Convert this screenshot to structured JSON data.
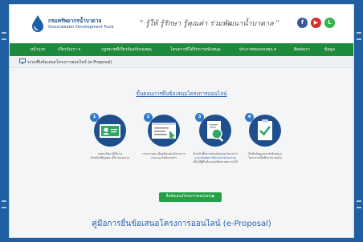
{
  "header": {
    "org_name_th": "กรมทรัพยากรน้ำบาดาล",
    "org_name_en": "Groundwater Development Fund",
    "slogan": "\" รู้ให้ รู้รักษา รู้คุณค่า ร่วมพัฒนาน้ำบาดาล \"",
    "social": [
      {
        "icon": "facebook-icon",
        "glyph": "f",
        "color": "#3b5998"
      },
      {
        "icon": "youtube-icon",
        "glyph": "▶",
        "color": "#d62d2d"
      },
      {
        "icon": "line-icon",
        "glyph": "L",
        "color": "#2fb34a"
      }
    ]
  },
  "nav": {
    "items": [
      "หน้าแรก",
      "เกี่ยวกับเรา ▾",
      "กฎหมายที่เกี่ยวข้องกับกองทุน",
      "โครงการที่ได้รับการสนับสนุน",
      "ประกาศของกองทุน ▾",
      "ติดต่อเรา",
      "ข้อมูล"
    ],
    "color": "#1e8a3c"
  },
  "breadcrumb": {
    "label": "ระบบยื่นข้อเสนอโครงการออนไลน์ (e-Proposal)"
  },
  "content": {
    "steps_title": "ขั้นตอนการยื่นข้อเสนอโครงการออนไลน์",
    "steps": [
      {
        "badge": "1",
        "icon": "id-card-icon",
        "caption_line1": "ลงทะเบียน ผู้ใช้งาน",
        "caption_line2": "สำหรับนิติบุคคล หรือ หน่วยงาน"
      },
      {
        "badge": "2",
        "icon": "online-form-icon",
        "caption_line1": "กรอกรายละเอียดข้อเสนอโครงการ",
        "caption_line2": "และแนบไฟล์เอกสาร"
      },
      {
        "badge": "3",
        "icon": "document-search-icon",
        "caption_line1": "เจ้าหน้าที่ตรวจสอบข้อเสนอโครงการ",
        "caption_line2": "และแจ้งผลการพิจารณาผ่านระบบ",
        "caption_line3": "เพื่อให้ผู้ยื่นข้อเสนอติดตามสถานะได้"
      },
      {
        "badge": "4",
        "icon": "checklist-icon",
        "caption_line1": "ยืนยันข้อมูลและส่งข้อเสนอ",
        "caption_line2": "โครงการเพื่อพิจารณาต่อไป"
      }
    ],
    "cta_label": "ยื่นข้อเสนอโครงการออนไลน์ ▶",
    "manual_title": "คู่มือการยื่นข้อเสนอโครงการออนไลน์ (e-Proposal)"
  },
  "colors": {
    "frame": "#1f5fa2",
    "step_circle": "#1e4f8c",
    "badge": "#2e7bd0",
    "cta": "#25a046",
    "link": "#2a62b0"
  }
}
